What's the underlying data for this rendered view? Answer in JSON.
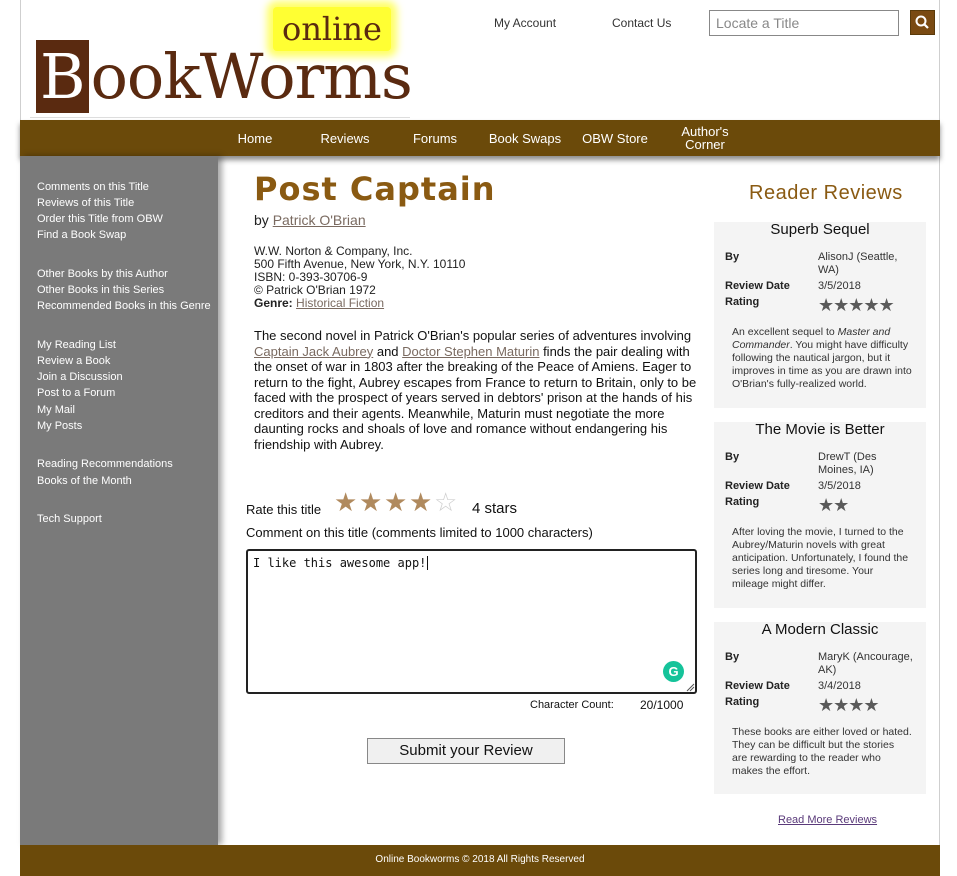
{
  "logo": {
    "online": "online",
    "first_letter": "B",
    "rest": "ookWorms"
  },
  "header": {
    "my_account": "My Account",
    "contact_us": "Contact Us",
    "search_placeholder": "Locate a Title"
  },
  "nav": [
    "Home",
    "Reviews",
    "Forums",
    "Book Swaps",
    "OBW Store",
    "Author's Corner"
  ],
  "sidebar": [
    "Comments on this Title",
    "Reviews of this Title",
    "Order this Title from OBW",
    "Find a Book Swap",
    "Other Books by this Author",
    "Other Books in this Series",
    "Recommended Books in this Genre",
    "My Reading List",
    "Review a Book",
    "Join a Discussion",
    "Post to a Forum",
    "My Mail",
    "My Posts",
    "Reading Recommendations",
    "Books of the Month",
    "Tech Support"
  ],
  "book": {
    "title": "Post Captain",
    "by": "by",
    "author": "Patrick O'Brian",
    "publisher": "W.W. Norton & Company, Inc.",
    "address": "500 Fifth Avenue, New York, N.Y. 10110",
    "isbn": "ISBN: 0-393-30706-9",
    "copyright": "© Patrick O'Brian 1972",
    "genre_label": "Genre:",
    "genre": "Historical Fiction",
    "desc_1": "The second novel in Patrick O'Brian's popular series of adventures involving ",
    "desc_link1": "Captain Jack Aubrey",
    "desc_and": " and ",
    "desc_link2": "Doctor Stephen Maturin",
    "desc_2": " finds the pair dealing with the onset of war in 1803 after the breaking of the Peace of Amiens. Eager to return to the fight, Aubrey escapes from France to return to Britain, only to be faced with the prospect of years served in debtors' prison at the hands of his creditors and their agents. Meanwhile, Maturin must negotiate the more daunting rocks and shoals of love and romance without endangering his friendship with Aubrey."
  },
  "rating": {
    "label": "Rate this title",
    "value": 4,
    "max": 5,
    "text": "4 stars",
    "filled_color": "#b08a5e",
    "empty_color": "#cfcfcf"
  },
  "comment": {
    "label": "Comment on this title (comments limited to 1000 characters)",
    "value": "I like this awesome app!",
    "grammarly_letter": "G",
    "char_count_label": "Character Count:",
    "char_count": "20/1000",
    "submit": "Submit your Review"
  },
  "reviews": {
    "heading": "Reader Reviews",
    "by_label": "By",
    "date_label": "Review Date",
    "rating_label": "Rating",
    "items": [
      {
        "title": "Superb Sequel",
        "by": "AlisonJ (Seattle, WA)",
        "date": "3/5/2018",
        "stars": 5,
        "stars_text": "★★★★★",
        "text_a": "An excellent sequel to ",
        "text_em": "Master and Commander",
        "text_b": ". You might have difficulty following the nautical jargon, but it improves in time as you are drawn into O'Brian's fully-realized world."
      },
      {
        "title": "The Movie is Better",
        "by": "DrewT (Des Moines, IA)",
        "date": "3/5/2018",
        "stars": 2,
        "stars_text": "★★",
        "text_a": "After loving the movie, I turned to the Aubrey/Maturin novels with great anticipation. Unfortunately, I found the series long and tiresome. Your mileage might differ.",
        "text_em": "",
        "text_b": ""
      },
      {
        "title": "A Modern Classic",
        "by": "MaryK (Ancourage, AK)",
        "date": "3/4/2018",
        "stars": 4,
        "stars_text": "★★★★",
        "text_a": "These books are either loved or hated. They can be difficult but the stories are rewarding to the reader who makes the effort.",
        "text_em": "",
        "text_b": ""
      }
    ],
    "read_more": "Read More Reviews"
  },
  "footer": "Online Bookworms © 2018 All Rights Reserved",
  "colors": {
    "brand_brown": "#6b4a0a",
    "title_brown": "#8a5a12",
    "sidebar_gray": "#7a7a7a"
  }
}
